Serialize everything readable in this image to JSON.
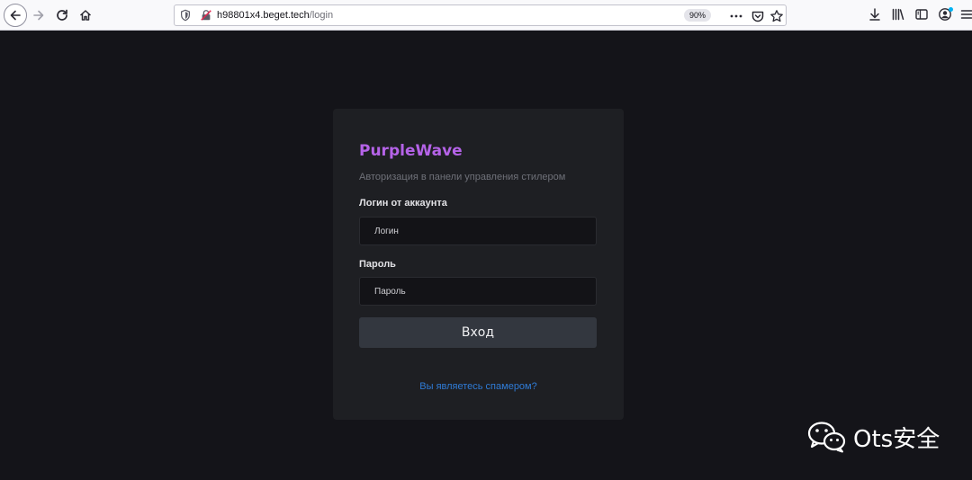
{
  "browser": {
    "url_host": "h98801x4.beget.tech",
    "url_path": "/login",
    "zoom": "90%",
    "icons": {
      "back": "back-arrow-icon",
      "forward": "forward-arrow-icon",
      "reload": "reload-icon",
      "home": "home-icon",
      "shield": "tracking-shield-icon",
      "insecure": "insecure-lock-icon",
      "more": "more-actions-icon",
      "pocket": "pocket-icon",
      "bookmark": "bookmark-star-icon",
      "downloads": "download-icon",
      "library": "library-icon",
      "sidebar": "sidebar-icon",
      "account": "account-icon",
      "menu": "hamburger-menu-icon"
    }
  },
  "login": {
    "brand": "PurpleWave",
    "subtitle": "Авторизация в панели управления стилером",
    "login_label": "Логин от аккаунта",
    "login_placeholder": "Логин",
    "password_label": "Пароль",
    "password_placeholder": "Пароль",
    "submit_label": "Вход",
    "spam_link": "Вы являетесь спамером?",
    "colors": {
      "brand": "#b563e8",
      "link": "#2f7bd6",
      "background": "#141419",
      "card": "#1e1f23"
    }
  },
  "watermark": {
    "text": "Ots安全",
    "icon": "wechat-icon"
  }
}
